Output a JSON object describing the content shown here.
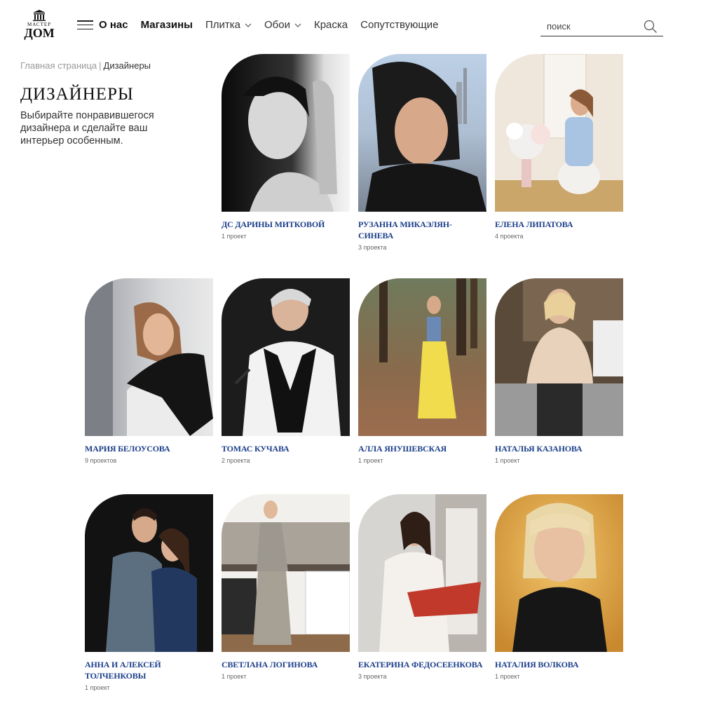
{
  "header": {
    "logo": {
      "top": "МАСТЕР",
      "bottom": "ДОМ"
    },
    "nav": [
      {
        "label": "О нас",
        "bold": true,
        "dropdown": false
      },
      {
        "label": "Магазины",
        "bold": true,
        "dropdown": false
      },
      {
        "label": "Плитка",
        "bold": false,
        "dropdown": true
      },
      {
        "label": "Обои",
        "bold": false,
        "dropdown": true
      },
      {
        "label": "Краска",
        "bold": false,
        "dropdown": false
      },
      {
        "label": "Сопутствующие",
        "bold": false,
        "dropdown": false
      }
    ],
    "search": {
      "placeholder": "поиск",
      "value": ""
    }
  },
  "breadcrumb": {
    "home": "Главная страница",
    "separator": "|",
    "current": "Дизайнеры"
  },
  "page": {
    "title": "ДИЗАЙНЕРЫ",
    "intro": "Выбирайте понравившегося дизайнера и сделайте ваш интерьер особенным."
  },
  "colors": {
    "accent": "#1c3f8a",
    "text": "#222222",
    "muted": "#999999"
  },
  "designers": [
    {
      "name": "ДС Дарины Митковой",
      "projects": "1 проект",
      "photo": "bw-portrait"
    },
    {
      "name": "Рузанна Микаэлян-Синева",
      "projects": "3 проекта",
      "photo": "city-portrait"
    },
    {
      "name": "Елена Липатова",
      "projects": "4 проекта",
      "photo": "interior-flowers"
    },
    {
      "name": "Мария Белоусова",
      "projects": "9 проектов",
      "photo": "studio-chair"
    },
    {
      "name": "Томас Кучава",
      "projects": "2 проекта",
      "photo": "dark-studio"
    },
    {
      "name": "Алла Янушевская",
      "projects": "1 проект",
      "photo": "forest"
    },
    {
      "name": "Наталья Казанова",
      "projects": "1 проект",
      "photo": "cafe"
    },
    {
      "name": "Анна и Алексей Толченковы",
      "projects": "1 проект",
      "photo": "couple"
    },
    {
      "name": "Светлана Логинова",
      "projects": "1 проект",
      "photo": "kitchen"
    },
    {
      "name": "Екатерина Федосеенкова",
      "projects": "3 проекта",
      "photo": "showroom"
    },
    {
      "name": "Наталия Волкова",
      "projects": "1 проект",
      "photo": "golden"
    }
  ]
}
